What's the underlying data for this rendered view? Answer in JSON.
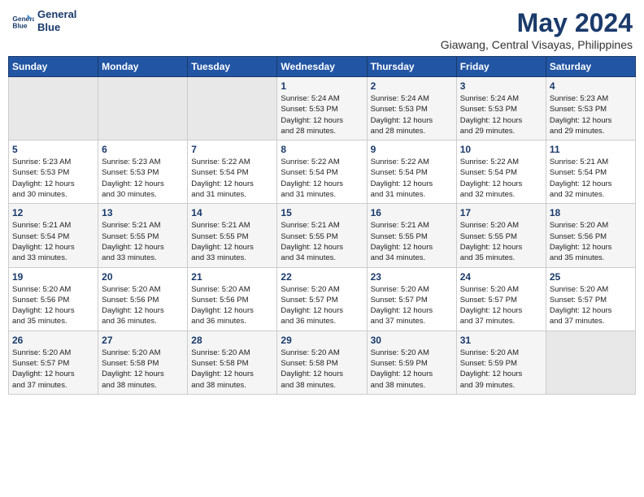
{
  "header": {
    "logo_line1": "General",
    "logo_line2": "Blue",
    "month": "May 2024",
    "location": "Giawang, Central Visayas, Philippines"
  },
  "weekdays": [
    "Sunday",
    "Monday",
    "Tuesday",
    "Wednesday",
    "Thursday",
    "Friday",
    "Saturday"
  ],
  "weeks": [
    [
      {
        "day": "",
        "info": ""
      },
      {
        "day": "",
        "info": ""
      },
      {
        "day": "",
        "info": ""
      },
      {
        "day": "1",
        "info": "Sunrise: 5:24 AM\nSunset: 5:53 PM\nDaylight: 12 hours\nand 28 minutes."
      },
      {
        "day": "2",
        "info": "Sunrise: 5:24 AM\nSunset: 5:53 PM\nDaylight: 12 hours\nand 28 minutes."
      },
      {
        "day": "3",
        "info": "Sunrise: 5:24 AM\nSunset: 5:53 PM\nDaylight: 12 hours\nand 29 minutes."
      },
      {
        "day": "4",
        "info": "Sunrise: 5:23 AM\nSunset: 5:53 PM\nDaylight: 12 hours\nand 29 minutes."
      }
    ],
    [
      {
        "day": "5",
        "info": "Sunrise: 5:23 AM\nSunset: 5:53 PM\nDaylight: 12 hours\nand 30 minutes."
      },
      {
        "day": "6",
        "info": "Sunrise: 5:23 AM\nSunset: 5:53 PM\nDaylight: 12 hours\nand 30 minutes."
      },
      {
        "day": "7",
        "info": "Sunrise: 5:22 AM\nSunset: 5:54 PM\nDaylight: 12 hours\nand 31 minutes."
      },
      {
        "day": "8",
        "info": "Sunrise: 5:22 AM\nSunset: 5:54 PM\nDaylight: 12 hours\nand 31 minutes."
      },
      {
        "day": "9",
        "info": "Sunrise: 5:22 AM\nSunset: 5:54 PM\nDaylight: 12 hours\nand 31 minutes."
      },
      {
        "day": "10",
        "info": "Sunrise: 5:22 AM\nSunset: 5:54 PM\nDaylight: 12 hours\nand 32 minutes."
      },
      {
        "day": "11",
        "info": "Sunrise: 5:21 AM\nSunset: 5:54 PM\nDaylight: 12 hours\nand 32 minutes."
      }
    ],
    [
      {
        "day": "12",
        "info": "Sunrise: 5:21 AM\nSunset: 5:54 PM\nDaylight: 12 hours\nand 33 minutes."
      },
      {
        "day": "13",
        "info": "Sunrise: 5:21 AM\nSunset: 5:55 PM\nDaylight: 12 hours\nand 33 minutes."
      },
      {
        "day": "14",
        "info": "Sunrise: 5:21 AM\nSunset: 5:55 PM\nDaylight: 12 hours\nand 33 minutes."
      },
      {
        "day": "15",
        "info": "Sunrise: 5:21 AM\nSunset: 5:55 PM\nDaylight: 12 hours\nand 34 minutes."
      },
      {
        "day": "16",
        "info": "Sunrise: 5:21 AM\nSunset: 5:55 PM\nDaylight: 12 hours\nand 34 minutes."
      },
      {
        "day": "17",
        "info": "Sunrise: 5:20 AM\nSunset: 5:55 PM\nDaylight: 12 hours\nand 35 minutes."
      },
      {
        "day": "18",
        "info": "Sunrise: 5:20 AM\nSunset: 5:56 PM\nDaylight: 12 hours\nand 35 minutes."
      }
    ],
    [
      {
        "day": "19",
        "info": "Sunrise: 5:20 AM\nSunset: 5:56 PM\nDaylight: 12 hours\nand 35 minutes."
      },
      {
        "day": "20",
        "info": "Sunrise: 5:20 AM\nSunset: 5:56 PM\nDaylight: 12 hours\nand 36 minutes."
      },
      {
        "day": "21",
        "info": "Sunrise: 5:20 AM\nSunset: 5:56 PM\nDaylight: 12 hours\nand 36 minutes."
      },
      {
        "day": "22",
        "info": "Sunrise: 5:20 AM\nSunset: 5:57 PM\nDaylight: 12 hours\nand 36 minutes."
      },
      {
        "day": "23",
        "info": "Sunrise: 5:20 AM\nSunset: 5:57 PM\nDaylight: 12 hours\nand 37 minutes."
      },
      {
        "day": "24",
        "info": "Sunrise: 5:20 AM\nSunset: 5:57 PM\nDaylight: 12 hours\nand 37 minutes."
      },
      {
        "day": "25",
        "info": "Sunrise: 5:20 AM\nSunset: 5:57 PM\nDaylight: 12 hours\nand 37 minutes."
      }
    ],
    [
      {
        "day": "26",
        "info": "Sunrise: 5:20 AM\nSunset: 5:57 PM\nDaylight: 12 hours\nand 37 minutes."
      },
      {
        "day": "27",
        "info": "Sunrise: 5:20 AM\nSunset: 5:58 PM\nDaylight: 12 hours\nand 38 minutes."
      },
      {
        "day": "28",
        "info": "Sunrise: 5:20 AM\nSunset: 5:58 PM\nDaylight: 12 hours\nand 38 minutes."
      },
      {
        "day": "29",
        "info": "Sunrise: 5:20 AM\nSunset: 5:58 PM\nDaylight: 12 hours\nand 38 minutes."
      },
      {
        "day": "30",
        "info": "Sunrise: 5:20 AM\nSunset: 5:59 PM\nDaylight: 12 hours\nand 38 minutes."
      },
      {
        "day": "31",
        "info": "Sunrise: 5:20 AM\nSunset: 5:59 PM\nDaylight: 12 hours\nand 39 minutes."
      },
      {
        "day": "",
        "info": ""
      }
    ]
  ]
}
